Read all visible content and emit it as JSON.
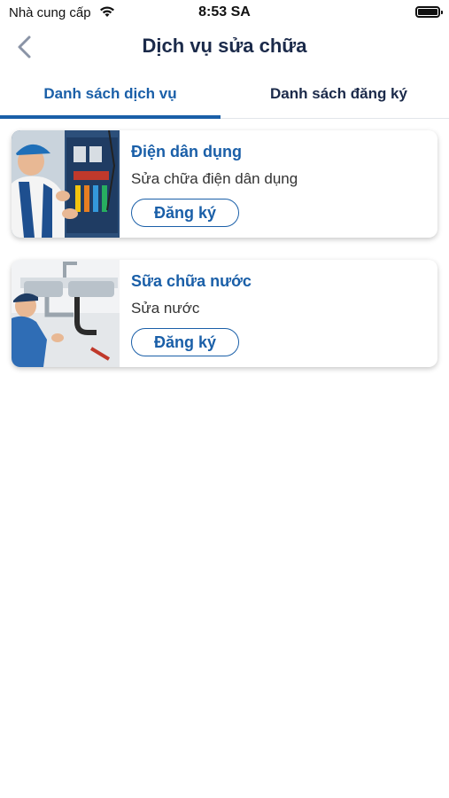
{
  "status_bar": {
    "carrier": "Nhà cung cấp",
    "time": "8:53 SA"
  },
  "header": {
    "title": "Dịch vụ sửa chữa"
  },
  "tabs": [
    {
      "label": "Danh sách dịch vụ",
      "active": true
    },
    {
      "label": "Danh sách đăng ký",
      "active": false
    }
  ],
  "services": [
    {
      "title": "Điện dân dụng",
      "subtitle": "Sửa chữa điện dân dụng",
      "button": "Đăng ký",
      "image": "electrician-photo"
    },
    {
      "title": "Sữa chữa nước",
      "subtitle": "Sửa nước",
      "button": "Đăng ký",
      "image": "plumber-photo"
    }
  ],
  "colors": {
    "accent": "#1a5fa8",
    "title_text": "#1b2a4a"
  }
}
